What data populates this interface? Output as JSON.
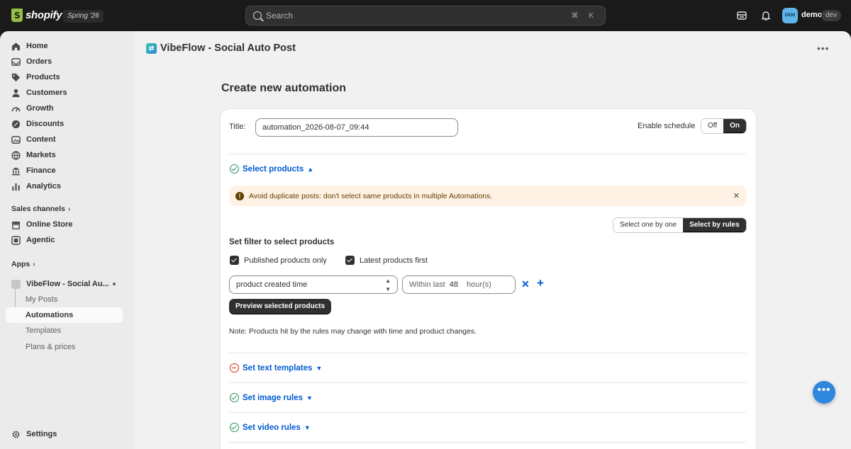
{
  "topbar": {
    "brand": "shopify",
    "edition": "Spring '26",
    "search_placeholder": "Search",
    "search_shortcut": "⌘ K",
    "avatar_initials": "DEM",
    "user_name": "demo",
    "user_badge": "dev"
  },
  "sidebar": {
    "items": [
      {
        "label": "Home",
        "icon": "home-icon"
      },
      {
        "label": "Orders",
        "icon": "inbox-icon"
      },
      {
        "label": "Products",
        "icon": "tag-icon"
      },
      {
        "label": "Customers",
        "icon": "person-icon"
      },
      {
        "label": "Growth",
        "icon": "gauge-icon"
      },
      {
        "label": "Discounts",
        "icon": "discount-icon"
      },
      {
        "label": "Content",
        "icon": "content-icon"
      },
      {
        "label": "Markets",
        "icon": "globe-icon"
      },
      {
        "label": "Finance",
        "icon": "bank-icon"
      },
      {
        "label": "Analytics",
        "icon": "bar-chart-icon"
      }
    ],
    "sales_channels_label": "Sales channels",
    "channels": [
      {
        "label": "Online Store",
        "icon": "store-icon"
      },
      {
        "label": "Agentic",
        "icon": "agent-icon"
      }
    ],
    "apps_label": "Apps",
    "app_name": "VibeFlow - Social Au...",
    "app_subitems": [
      "My Posts",
      "Automations",
      "Templates",
      "Plans & prices"
    ],
    "settings_label": "Settings"
  },
  "app": {
    "title": "VibeFlow - Social Auto Post",
    "page_title": "Create new automation"
  },
  "form": {
    "title_label": "Title:",
    "title_value": "automation_2026-08-07_09:44",
    "schedule_label": "Enable schedule",
    "schedule_off": "Off",
    "schedule_on": "On",
    "select_products_label": "Select products",
    "banner_text": "Avoid duplicate posts: don't select same products in multiple Automations.",
    "mode_one": "Select one by one",
    "mode_rules": "Select by rules",
    "filter_title": "Set filter to select products",
    "published_only": "Published products only",
    "latest_first": "Latest products first",
    "rule_field": "product created time",
    "within_label": "Within last",
    "within_value": "48",
    "within_unit": "hour(s)",
    "preview_button": "Preview selected products",
    "note": "Note: Products hit by the rules may change with time and product changes.",
    "text_templates_label": "Set text templates",
    "image_rules_label": "Set image rules",
    "video_rules_label": "Set video rules"
  },
  "colors": {
    "accent": "#005bd3",
    "success": "#2e8f5f",
    "critical": "#d72c0d",
    "warning_bg": "#fff1e3"
  }
}
